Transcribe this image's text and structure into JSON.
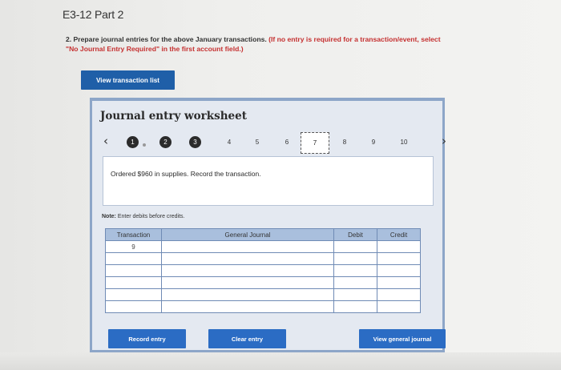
{
  "page_title": "E3-12 Part 2",
  "instructions": {
    "main": "2. Prepare journal entries for the above January transactions.",
    "hint": "(If no entry is required for a transaction/event, select \"No Journal Entry Required\" in the first account field.)"
  },
  "view_transaction_label": "View transaction list",
  "worksheet": {
    "title": "Journal entry worksheet",
    "prev_glyph": "‹",
    "next_glyph": "›",
    "steps": [
      {
        "label": "1",
        "state": "done"
      },
      {
        "label": "2",
        "state": "done"
      },
      {
        "label": "3",
        "state": "done"
      },
      {
        "label": "4",
        "state": "plain"
      },
      {
        "label": "5",
        "state": "plain"
      },
      {
        "label": "6",
        "state": "plain"
      },
      {
        "label": "7",
        "state": "current"
      },
      {
        "label": "8",
        "state": "plain"
      },
      {
        "label": "9",
        "state": "plain"
      },
      {
        "label": "10",
        "state": "plain"
      }
    ],
    "prompt": "Ordered $960 in supplies. Record the transaction.",
    "note_label": "Note:",
    "note_text": "Enter debits before credits.",
    "table": {
      "headers": [
        "Transaction",
        "General Journal",
        "Debit",
        "Credit"
      ],
      "rows": [
        {
          "transaction": "9",
          "account": "",
          "debit": "",
          "credit": ""
        },
        {
          "transaction": "",
          "account": "",
          "debit": "",
          "credit": ""
        },
        {
          "transaction": "",
          "account": "",
          "debit": "",
          "credit": ""
        },
        {
          "transaction": "",
          "account": "",
          "debit": "",
          "credit": ""
        },
        {
          "transaction": "",
          "account": "",
          "debit": "",
          "credit": ""
        },
        {
          "transaction": "",
          "account": "",
          "debit": "",
          "credit": ""
        }
      ]
    },
    "buttons": {
      "record": "Record entry",
      "clear": "Clear entry",
      "view_journal": "View general journal"
    }
  },
  "colors": {
    "primary_button": "#2b6cc4",
    "worksheet_border": "#8da6c8",
    "header_fill": "#a9bfdd",
    "hint_red": "#c53030"
  }
}
